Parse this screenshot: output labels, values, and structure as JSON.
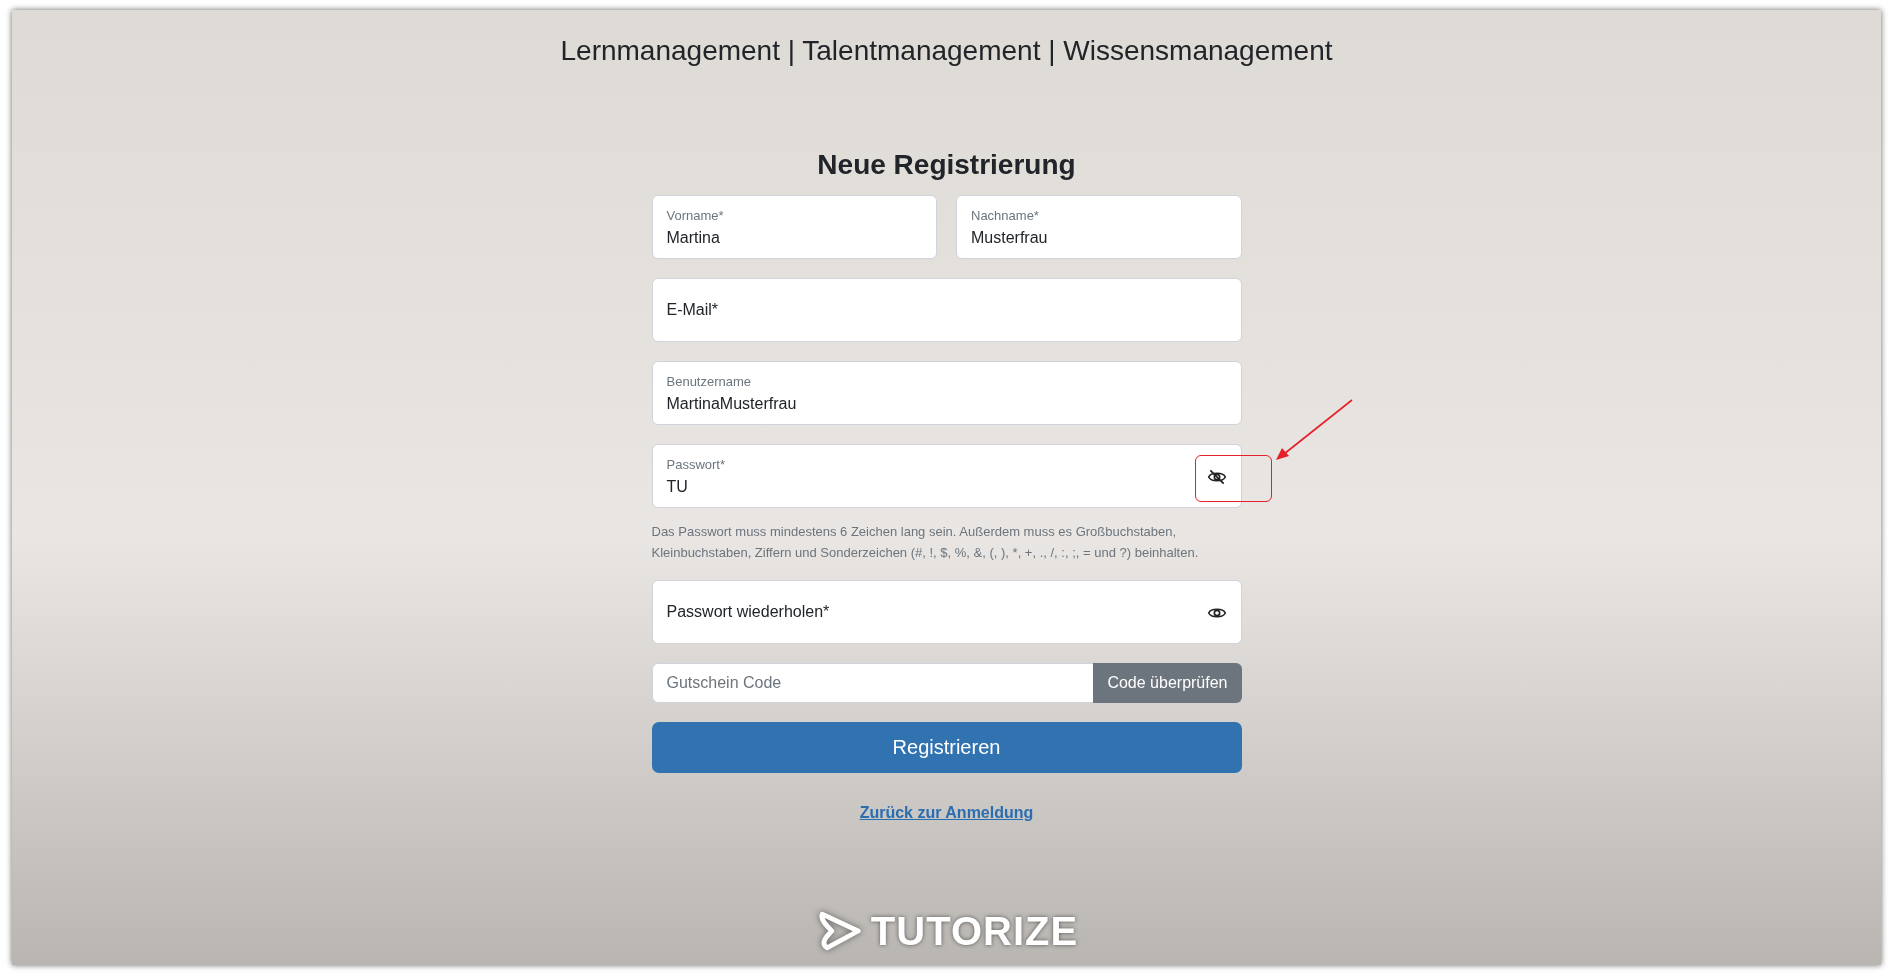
{
  "header": {
    "title": "Lernmanagement | Talentmanagement | Wissensmanagement"
  },
  "form": {
    "heading": "Neue Registrierung",
    "name_fields": [
      {
        "label": "Vorname*",
        "value": "Martina"
      },
      {
        "label": "Nachname*",
        "value": "Musterfrau"
      }
    ],
    "fields": [
      {
        "kind": "text",
        "label": "E-Mail*"
      },
      {
        "kind": "text",
        "label": "Benutzername",
        "value": "MartinaMusterfrau"
      },
      {
        "kind": "password",
        "label": "Passwort*",
        "value": "TU",
        "revealed": true,
        "annotated": true
      },
      {
        "kind": "hint",
        "text": "Das Passwort muss mindestens 6 Zeichen lang sein. Außerdem muss es Großbuchstaben, Kleinbuchstaben, Ziffern und Sonderzeichen (#, !, $, %, &, (, ), *, +, ., /, :, ;, = und ?) beinhalten."
      },
      {
        "kind": "password",
        "label": "Passwort wiederholen*",
        "revealed": false,
        "annotated": false
      }
    ],
    "voucher": {
      "placeholder": "Gutschein Code",
      "button": "Code überprüfen"
    },
    "submit": "Registrieren",
    "back_link": "Zurück zur Anmeldung"
  },
  "logo": {
    "text": "TUTORIZE"
  }
}
